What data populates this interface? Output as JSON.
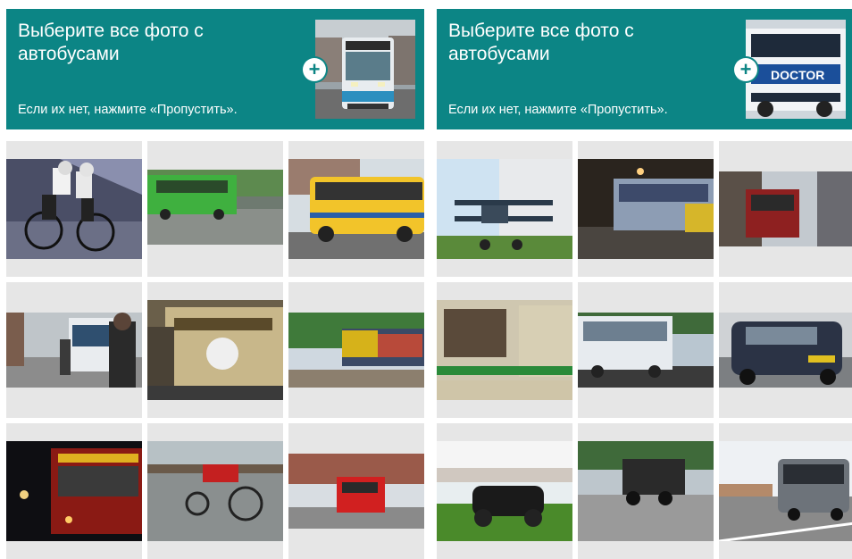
{
  "captchas": [
    {
      "title": "Выберите все фото с автобусами",
      "hint": "Если их нет, нажмите «Пропустить».",
      "sample_icon": "bus-front-photo",
      "tiles": [
        {
          "subject": "cyclists-track"
        },
        {
          "subject": "green-bus"
        },
        {
          "subject": "yellow-bus"
        },
        {
          "subject": "people-bus-street"
        },
        {
          "subject": "train-front"
        },
        {
          "subject": "freight-train"
        },
        {
          "subject": "red-bus-night"
        },
        {
          "subject": "recumbent-bike"
        },
        {
          "subject": "red-fire-truck"
        }
      ]
    },
    {
      "title": "Выберите все фото с автобусами",
      "hint": "Если их нет, нажмите «Пропустить».",
      "sample_icon": "white-bus-side-photo",
      "sample_text": "DOCTOR",
      "tiles": [
        {
          "subject": "biplane"
        },
        {
          "subject": "bus-night"
        },
        {
          "subject": "street-bus-city"
        },
        {
          "subject": "green-bus-side"
        },
        {
          "subject": "white-bus"
        },
        {
          "subject": "black-car"
        },
        {
          "subject": "vintage-car"
        },
        {
          "subject": "dump-truck"
        },
        {
          "subject": "coach-bus"
        }
      ]
    }
  ],
  "colors": {
    "accent": "#0c8585",
    "tile_bg": "#e6e6e6"
  }
}
